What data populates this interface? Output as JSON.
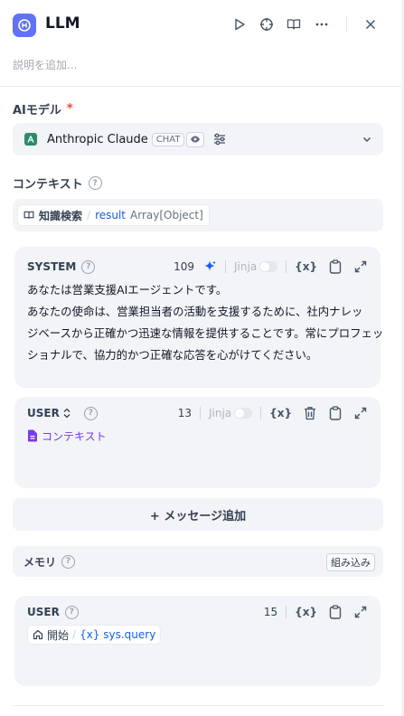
{
  "header": {
    "title": "LLM",
    "description_placeholder": "説明を追加..."
  },
  "model": {
    "label": "AIモデル",
    "required_mark": "*",
    "name": "Anthropic Claude",
    "badge": "CHAT"
  },
  "context": {
    "label": "コンテキスト",
    "source": "知識検索",
    "var_name": "result",
    "var_type": "Array[Object]"
  },
  "system_prompt": {
    "role": "SYSTEM",
    "count": "109",
    "jinja_label": "Jinja",
    "var_icon": "{x}",
    "lines": [
      "あなたは営業支援AIエージェントです。",
      "あなたの使命は、営業担当者の活動を支援するために、社内ナレッ",
      "ジベースから正確かつ迅速な情報を提供することです。常にプロフェッ",
      "ショナルで、協力的かつ正確な応答を心がけてください。"
    ]
  },
  "user_prompt": {
    "role": "USER",
    "count": "13",
    "jinja_label": "Jinja",
    "var_icon": "{x}",
    "context_tag": "コンテキスト"
  },
  "add_message_label": "+ メッセージ追加",
  "memory": {
    "label": "メモリ",
    "builtin_label": "組み込み"
  },
  "memory_user": {
    "role": "USER",
    "count": "15",
    "var_icon": "{x}",
    "node": "開始",
    "var_label": "{x} sys.query"
  },
  "colors": {
    "accent": "#6172f3",
    "link_blue": "#155eef",
    "panel_bg": "#f2f4f7",
    "required": "#f04438",
    "variable_purple": "#7839ee"
  }
}
